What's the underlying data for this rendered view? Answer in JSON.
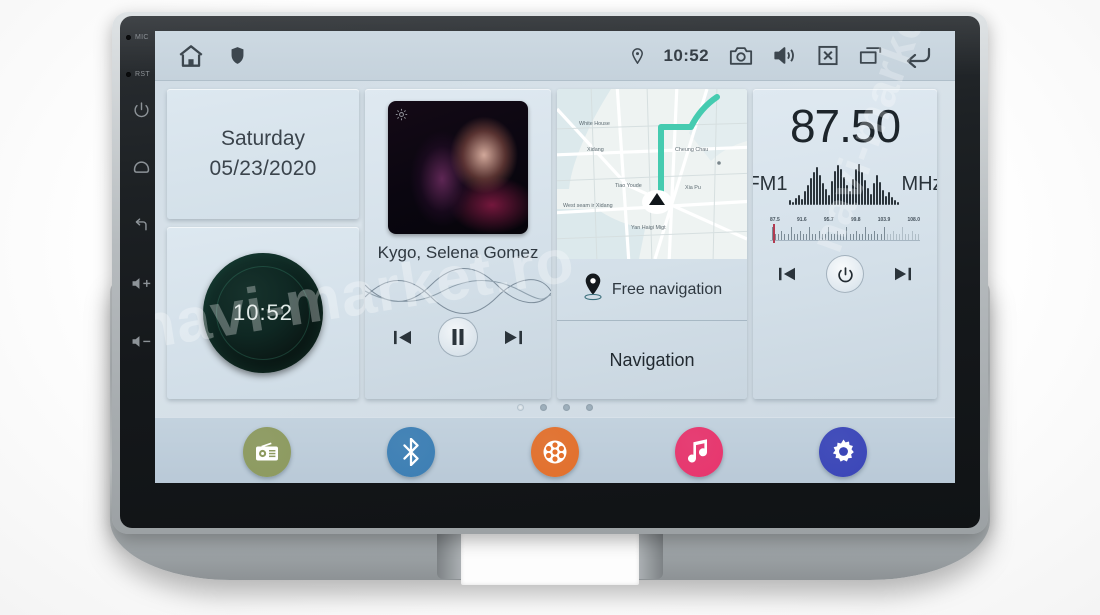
{
  "device": {
    "side_keys": [
      {
        "name": "mic-indicator",
        "label": "MIC"
      },
      {
        "name": "reset-indicator",
        "label": "RST"
      },
      {
        "name": "power-key",
        "label": ""
      },
      {
        "name": "home-key",
        "label": ""
      },
      {
        "name": "back-key",
        "label": ""
      },
      {
        "name": "volume-up-key",
        "label": ""
      },
      {
        "name": "volume-down-key",
        "label": ""
      }
    ]
  },
  "status_bar": {
    "home_icon": "home-icon",
    "shield_icon": "shield-icon",
    "location_icon": "location-pin-icon",
    "clock": "10:52",
    "camera_icon": "camera-icon",
    "volume_icon": "volume-icon",
    "close_icon": "close-box-icon",
    "recents_icon": "recents-icon",
    "back_icon": "back-arrow-icon"
  },
  "widgets": {
    "date": {
      "day": "Saturday",
      "date": "05/23/2020"
    },
    "clock": {
      "time": "10:52"
    },
    "music": {
      "title": "Kygo, Selena Gomez",
      "prev_icon": "previous-track-icon",
      "play_icon": "pause-icon",
      "next_icon": "next-track-icon"
    },
    "navigation": {
      "free_label": "Free navigation",
      "main_label": "Navigation",
      "pin_icon": "location-pin-icon",
      "marker_icon": "navigation-arrow-icon"
    },
    "radio": {
      "frequency": "87.50",
      "band": "FM1",
      "unit": "MHz",
      "scale_labels": [
        "87.5",
        "91.6",
        "95.7",
        "99.8",
        "103.9",
        "108.0"
      ],
      "prev_icon": "previous-station-icon",
      "power_icon": "power-icon",
      "next_icon": "next-station-icon"
    }
  },
  "page_indicator": {
    "total": 4,
    "active": 1
  },
  "dock": {
    "items": [
      {
        "name": "radio-app",
        "icon": "radio-icon",
        "color": "#8d9a5f"
      },
      {
        "name": "bluetooth-app",
        "icon": "bluetooth-icon",
        "color": "#3d7fb4"
      },
      {
        "name": "video-app",
        "icon": "film-reel-icon",
        "color": "#e3702c"
      },
      {
        "name": "music-app",
        "icon": "music-note-icon",
        "color": "#e8356d"
      },
      {
        "name": "settings-app",
        "icon": "gear-icon",
        "color": "#3b46b8"
      }
    ]
  },
  "watermark": {
    "text1": "navi-market.ro",
    "text2": "navi-market.ro"
  }
}
